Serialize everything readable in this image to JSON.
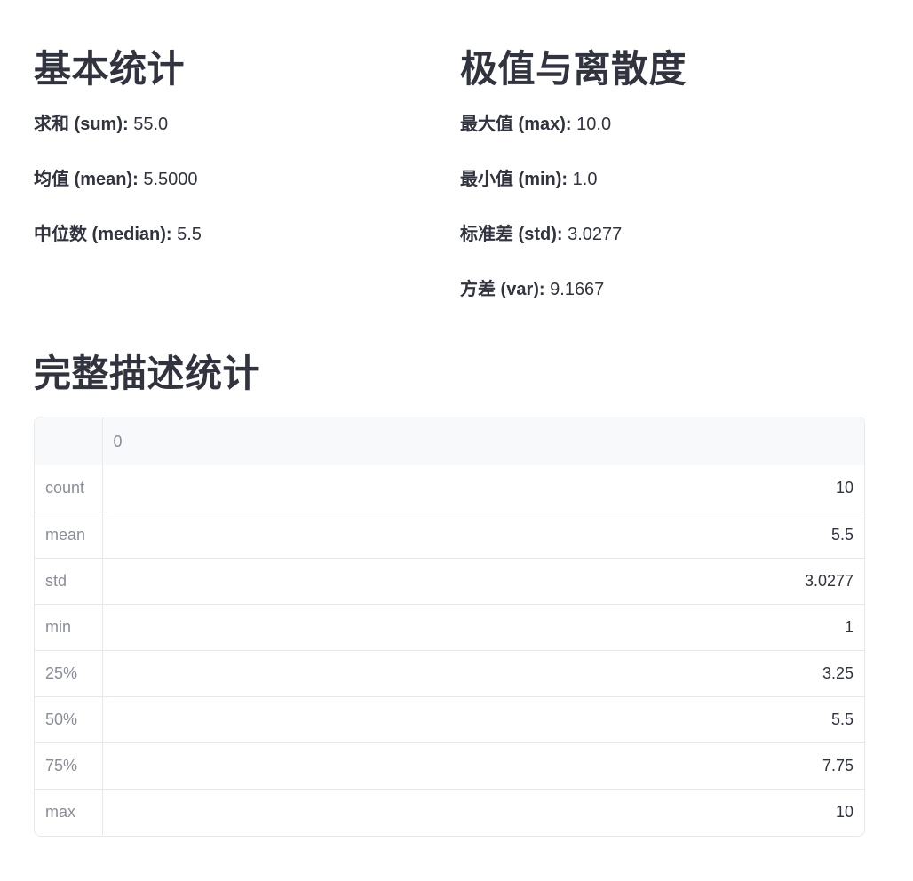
{
  "basic": {
    "title": "基本统计",
    "metrics": [
      {
        "label": "求和 (sum):",
        "value": " 55.0"
      },
      {
        "label": "均值 (mean):",
        "value": " 5.5000"
      },
      {
        "label": "中位数 (median):",
        "value": " 5.5"
      }
    ]
  },
  "extremes": {
    "title": "极值与离散度",
    "metrics": [
      {
        "label": "最大值 (max):",
        "value": " 10.0"
      },
      {
        "label": "最小值 (min):",
        "value": " 1.0"
      },
      {
        "label": "标准差 (std):",
        "value": " 3.0277"
      },
      {
        "label": "方差 (var):",
        "value": " 9.1667"
      }
    ]
  },
  "describe": {
    "title": "完整描述统计",
    "header": {
      "index": "",
      "column": "0"
    },
    "rows": [
      {
        "index": "count",
        "value": "10"
      },
      {
        "index": "mean",
        "value": "5.5"
      },
      {
        "index": "std",
        "value": "3.0277"
      },
      {
        "index": "min",
        "value": "1"
      },
      {
        "index": "25%",
        "value": "3.25"
      },
      {
        "index": "50%",
        "value": "5.5"
      },
      {
        "index": "75%",
        "value": "7.75"
      },
      {
        "index": "max",
        "value": "10"
      }
    ]
  },
  "colors": {
    "text": "#31333f",
    "muted": "#8a8d99",
    "border": "#e6e8ee",
    "header_bg": "#f8f9fb"
  }
}
